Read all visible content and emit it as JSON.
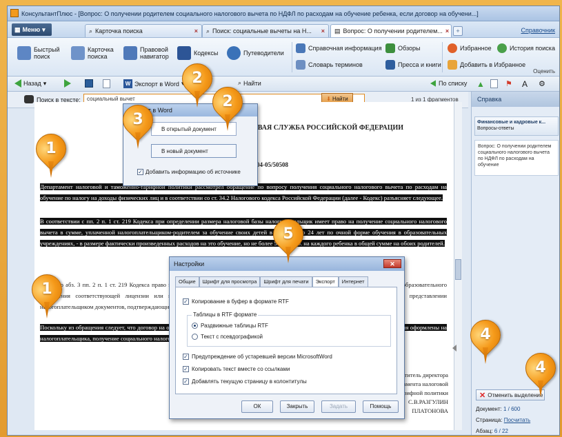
{
  "window": {
    "title": "КонсультантПлюс - [Вопрос: О получении родителем социального налогового вычета по НДФЛ по расходам на обучение ребенка, если договор на обучени...]"
  },
  "menu": {
    "label": "Меню"
  },
  "tabs": [
    {
      "label": "Карточка поиска"
    },
    {
      "label": "Поиск: социальные вычеты на Н..."
    },
    {
      "label": "Вопрос: О получении родителем..."
    }
  ],
  "top_right_link": "Справочник",
  "ribbon": {
    "quick_search": "Быстрый поиск",
    "search_card": "Карточка поиска",
    "legal_navigator": "Правовой навигатор",
    "codes": "Кодексы",
    "guides": "Путеводители",
    "reference_info": "Справочная информация",
    "reviews": "Обзоры",
    "dictionary": "Словарь терминов",
    "press": "Пресса и книги",
    "favorites": "Избранное",
    "history": "История поиска",
    "add_favorites": "Добавить в Избранное",
    "group_label": "Оценить"
  },
  "nav": {
    "back": "Назад",
    "export_word": "Экспорт в Word",
    "find": "Найти",
    "by_list": "По списку"
  },
  "search": {
    "label": "Поиск в тексте:",
    "value": "социальный вычет",
    "find_button": "Найти",
    "counter": "1 из 1 фрагментов"
  },
  "document": {
    "heading": "ФЕДЕРАЛЬНАЯ НАЛОГОВАЯ СЛУЖБА РОССИЙСКОЙ ФЕДЕРАЦИИ",
    "letter_num": "03-04-05/50508",
    "para1": "Департамент налоговой и таможенно-тарифной политики рассмотрел обращение по вопросу получения социального налогового вычета по расходам на обучение по налогу на доходы физических лиц и в соответствии со ст. 34.2 Налогового кодекса Российской Федерации (далее - Кодекс) разъясняет следующее.",
    "para2": "В соответствии с пп. 2 п. 1 ст. 219 Кодекса при определении размера налоговой базы налогоплательщик имеет право на получение социального налогового вычета в сумме, уплаченной налогоплательщиком-родителем за обучение своих детей в возрасте до 24 лет по очной форме обучения в образовательных учреждениях, - в размере фактически произведенных расходов на это обучение, но не более 50 000 руб. на каждого ребенка в общей сумме на обоих родителей.",
    "para3": "Согласно абз. 3 пп. 2 п. 1 ст. 219 Кодекса право на получение указанного вычета распространяется на налогоплательщика при наличии у образовательного учреждения соответствующей лицензии или иного документа, который подтверждает статус учебного заведения, а также при представлении налогоплательщиком документов, подтверждающих его фактические расходы на обучение.",
    "para4": "Поскольку из обращения следует, что договор на обучение заключен не с налогоплательщиком, а документы, подтверждающие оплату обучения оформлены на налогоплательщика, получение социального налогового вычета и сумме произведенных расходов возможно.",
    "signature_line1": "Заместитель директора",
    "signature_line2": "Департамента налоговой",
    "signature_line3": "и таможенно-тарифной политики",
    "signature_name": "С.В.РАЗГУЛИН",
    "signature_extra": "ПЛАТОНОВА"
  },
  "sidebar": {
    "title": "Справка",
    "section_title": "Финансовые и кадровые к...",
    "section_sub": "Вопросы-ответы",
    "body": "Вопрос: О получении родителем социального налогового вычета по НДФЛ по расходам на обучение",
    "cancel_button": "Отменить выделение",
    "doc_label": "Документ:",
    "doc_value": "1 / 600",
    "page_label": "Страница:",
    "page_value": "Посчитать",
    "para_label": "Абзац:",
    "para_value": "6 / 22"
  },
  "word_dialog": {
    "title": "Экспорт в Word",
    "option1": "В открытый документ",
    "option2": "В новый документ",
    "checkbox": "Добавить информацию об источнике"
  },
  "settings_dialog": {
    "title": "Настройки",
    "tabs": [
      "Общие",
      "Шрифт для просмотра",
      "Шрифт для печати",
      "Экспорт",
      "Интернет"
    ],
    "active_tab": "Экспорт",
    "copy_rtf": "Копирование в буфер в формате RTF",
    "group_label": "Таблицы в RTF формате",
    "radio1": "Раздвижные таблицы RTF",
    "radio2": "Текст с псевдографикой",
    "warn_word": "Предупреждение об устаревшей версии MicrosoftWord",
    "copy_links": "Копировать текст вместе со ссылками",
    "add_page": "Добавлять текущую страницу в колонтитулы",
    "ok": "ОК",
    "cancel": "Закрыть",
    "apply": "Задать",
    "help": "Помощь"
  },
  "callouts": [
    "1",
    "1",
    "2",
    "2",
    "3",
    "4",
    "4",
    "5"
  ],
  "colors": {
    "accent": "#f59a1a",
    "highlight": "#111111",
    "chrome": "#dfe8f3"
  }
}
